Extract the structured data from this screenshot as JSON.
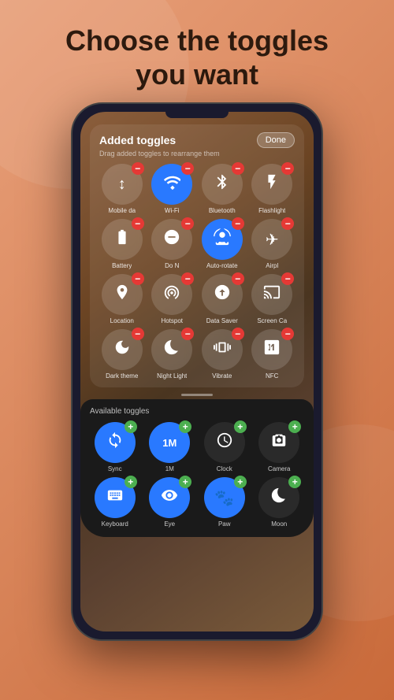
{
  "hero": {
    "title": "Choose the toggles",
    "title2": "you want"
  },
  "screen": {
    "added_section": {
      "title": "Added toggles",
      "subtitle": "Drag added toggles to rearrange them",
      "done_label": "Done",
      "toggles": [
        {
          "id": "mobile-data",
          "label": "Mobile da",
          "icon": "↕",
          "active": false
        },
        {
          "id": "wifi",
          "label": "Wi-Fi",
          "icon": "wifi",
          "active": true
        },
        {
          "id": "bluetooth",
          "label": "Bluetooth",
          "icon": "bt",
          "active": false
        },
        {
          "id": "flashlight",
          "label": "Flashlight",
          "icon": "flashlight",
          "active": false
        },
        {
          "id": "battery",
          "label": "Battery",
          "icon": "battery",
          "active": false
        },
        {
          "id": "do-not-disturb",
          "label": "Do N",
          "icon": "dnd",
          "active": false
        },
        {
          "id": "auto-rotate",
          "label": "Auto-rotate",
          "icon": "rotate",
          "active": true
        },
        {
          "id": "airplane",
          "label": "Airpl",
          "icon": "✈",
          "active": false
        },
        {
          "id": "location",
          "label": "Location",
          "icon": "📍",
          "active": false
        },
        {
          "id": "hotspot",
          "label": "Hotspot",
          "icon": "hotspot",
          "active": false
        },
        {
          "id": "data-saver",
          "label": "Data Saver",
          "icon": "datasaver",
          "active": false
        },
        {
          "id": "screen-cast",
          "label": "Screen Ca",
          "icon": "screencast",
          "active": false
        },
        {
          "id": "dark-theme",
          "label": "Dark theme",
          "icon": "darktheme",
          "active": false
        },
        {
          "id": "night-light",
          "label": "Night Light",
          "icon": "nightlight",
          "active": false
        },
        {
          "id": "vibrate",
          "label": "Vibrate",
          "icon": "vibrate",
          "active": false
        },
        {
          "id": "nfc",
          "label": "NFC",
          "icon": "nfc",
          "active": false
        }
      ]
    },
    "available_section": {
      "title": "Available toggles",
      "toggles": [
        {
          "id": "sync",
          "label": "Sync",
          "icon": "sync",
          "active": true
        },
        {
          "id": "1m",
          "label": "1M",
          "icon": "1m",
          "active": true
        },
        {
          "id": "clock",
          "label": "Clock",
          "icon": "clock",
          "active": false
        },
        {
          "id": "camera",
          "label": "Camera",
          "icon": "camera",
          "active": false
        },
        {
          "id": "keyboard",
          "label": "Keyboard",
          "icon": "keyboard",
          "active": true
        },
        {
          "id": "eye",
          "label": "Eye",
          "icon": "eye",
          "active": true
        },
        {
          "id": "paw",
          "label": "Paw",
          "icon": "paw",
          "active": true
        },
        {
          "id": "moon",
          "label": "Moon",
          "icon": "moon",
          "active": false
        }
      ]
    }
  }
}
